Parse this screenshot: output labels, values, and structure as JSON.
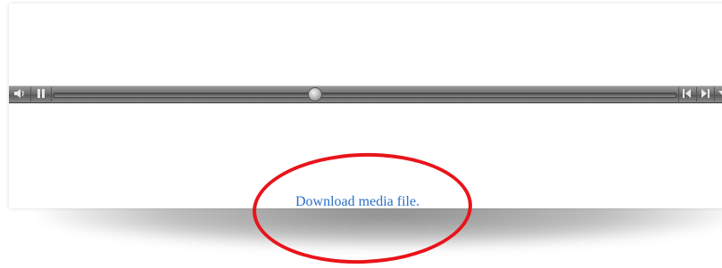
{
  "player": {
    "mute_icon": "speaker-icon",
    "pause_icon": "pause-icon",
    "prev_icon": "skip-back-icon",
    "next_icon": "skip-forward-icon",
    "menu_icon": "chevron-down-icon",
    "progress": 0.42
  },
  "download": {
    "label": "Download media file."
  },
  "colors": {
    "link": "#2a6fc9",
    "annotation": "#e8141a",
    "bar": "#707070"
  }
}
